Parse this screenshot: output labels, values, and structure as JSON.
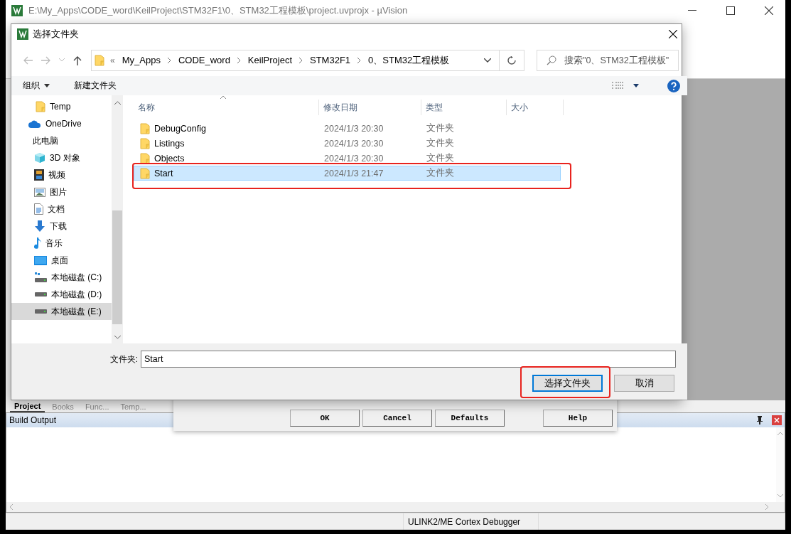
{
  "main_window": {
    "title": "E:\\My_Apps\\CODE_word\\KeilProject\\STM32F1\\0、STM32工程模板\\project.uvprojx - µVision"
  },
  "project_tabs": [
    {
      "label": "Project",
      "selected": true
    },
    {
      "label": "Books",
      "selected": false
    },
    {
      "label": "Func...",
      "selected": false
    },
    {
      "label": "Temp...",
      "selected": false
    }
  ],
  "build_output": {
    "title": "Build Output"
  },
  "status_bar": {
    "debugger": "ULINK2/ME Cortex Debugger"
  },
  "options_dialog": {
    "buttons": [
      "OK",
      "Cancel",
      "Defaults",
      "Help"
    ]
  },
  "folder_dialog": {
    "title": "选择文件夹",
    "overflow": "«",
    "breadcrumb": [
      "My_Apps",
      "CODE_word",
      "KeilProject",
      "STM32F1",
      "0、STM32工程模板"
    ],
    "search": {
      "placeholder": "搜索\"0、STM32工程模板\""
    },
    "toolbar": {
      "organize": "组织",
      "new_folder": "新建文件夹"
    },
    "quick_access": [
      {
        "label": "Temp",
        "kind": "folder",
        "selected": false
      }
    ],
    "nav": [
      {
        "label": "OneDrive",
        "kind": "cloud",
        "selected": false
      },
      {
        "label": "此电脑",
        "kind": "none",
        "selected": false,
        "children": [
          {
            "label": "3D 对象",
            "kind": "cube",
            "selected": false
          },
          {
            "label": "视频",
            "kind": "film",
            "selected": false
          },
          {
            "label": "图片",
            "kind": "image",
            "selected": false
          },
          {
            "label": "文档",
            "kind": "document",
            "selected": false
          },
          {
            "label": "下载",
            "kind": "download",
            "selected": false
          },
          {
            "label": "音乐",
            "kind": "music",
            "selected": false
          },
          {
            "label": "桌面",
            "kind": "desktop",
            "selected": false
          },
          {
            "label": "本地磁盘 (C:)",
            "kind": "system-drive",
            "selected": false
          },
          {
            "label": "本地磁盘 (D:)",
            "kind": "drive",
            "selected": false
          },
          {
            "label": "本地磁盘 (E:)",
            "kind": "drive",
            "selected": true
          }
        ]
      }
    ],
    "columns": [
      "名称",
      "修改日期",
      "类型",
      "大小"
    ],
    "rows": [
      {
        "name": "DebugConfig",
        "modified": "2024/1/3 20:30",
        "type": "文件夹",
        "selected": false,
        "framed": false
      },
      {
        "name": "Listings",
        "modified": "2024/1/3 20:30",
        "type": "文件夹",
        "selected": false,
        "framed": false
      },
      {
        "name": "Objects",
        "modified": "2024/1/3 20:30",
        "type": "文件夹",
        "selected": false,
        "framed": false
      },
      {
        "name": "Start",
        "modified": "2024/1/3 21:47",
        "type": "文件夹",
        "selected": true,
        "framed": true
      }
    ],
    "folder_field": {
      "label": "文件夹:",
      "value": "Start"
    },
    "buttons": [
      {
        "label": "选择文件夹",
        "focused": true,
        "framed": true
      },
      {
        "label": "取消",
        "focused": false,
        "framed": false
      }
    ]
  }
}
